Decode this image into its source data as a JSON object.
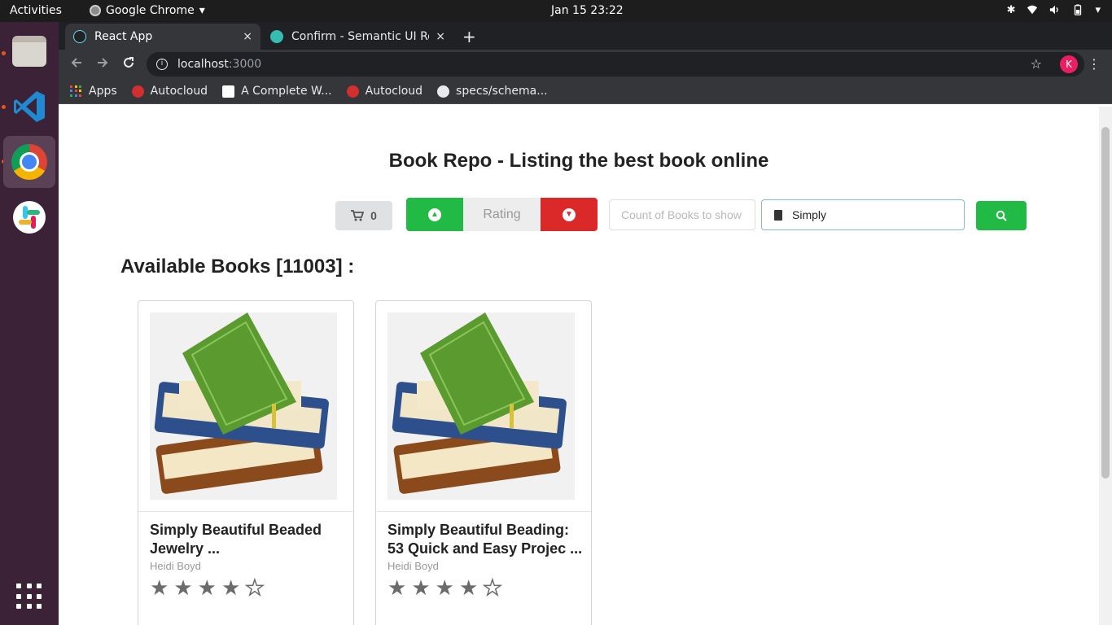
{
  "system": {
    "activities": "Activities",
    "app_name": "Google Chrome",
    "clock": "Jan 15  23:22"
  },
  "browser": {
    "tabs": [
      {
        "title": "React App",
        "close": "×",
        "active": true
      },
      {
        "title": "Confirm - Semantic UI Rea",
        "close": "×",
        "active": false
      }
    ],
    "new_tab": "+",
    "url_host": "localhost",
    "url_port": ":3000",
    "profile_initial": "K",
    "bookmarks": [
      {
        "label": "Apps"
      },
      {
        "label": "Autocloud"
      },
      {
        "label": "A Complete W..."
      },
      {
        "label": "Autocloud"
      },
      {
        "label": "specs/schema..."
      }
    ]
  },
  "page": {
    "title": "Book Repo - Listing the best book online",
    "cart_count": "0",
    "sort_label": "Rating",
    "count_placeholder": "Count of Books to show",
    "search_value": "Simply",
    "available_heading": "Available Books [11003] :",
    "books": [
      {
        "title": "Simply Beautiful Beaded Jewelry  ...",
        "author": "Heidi Boyd",
        "rating": 4,
        "max_rating": 5
      },
      {
        "title": "Simply Beautiful Beading: 53 Quick and Easy Projec  ...",
        "author": "Heidi Boyd",
        "rating": 4,
        "max_rating": 5
      }
    ]
  },
  "colors": {
    "green": "#21ba45",
    "red": "#db2828",
    "dock": "#3b2236"
  }
}
